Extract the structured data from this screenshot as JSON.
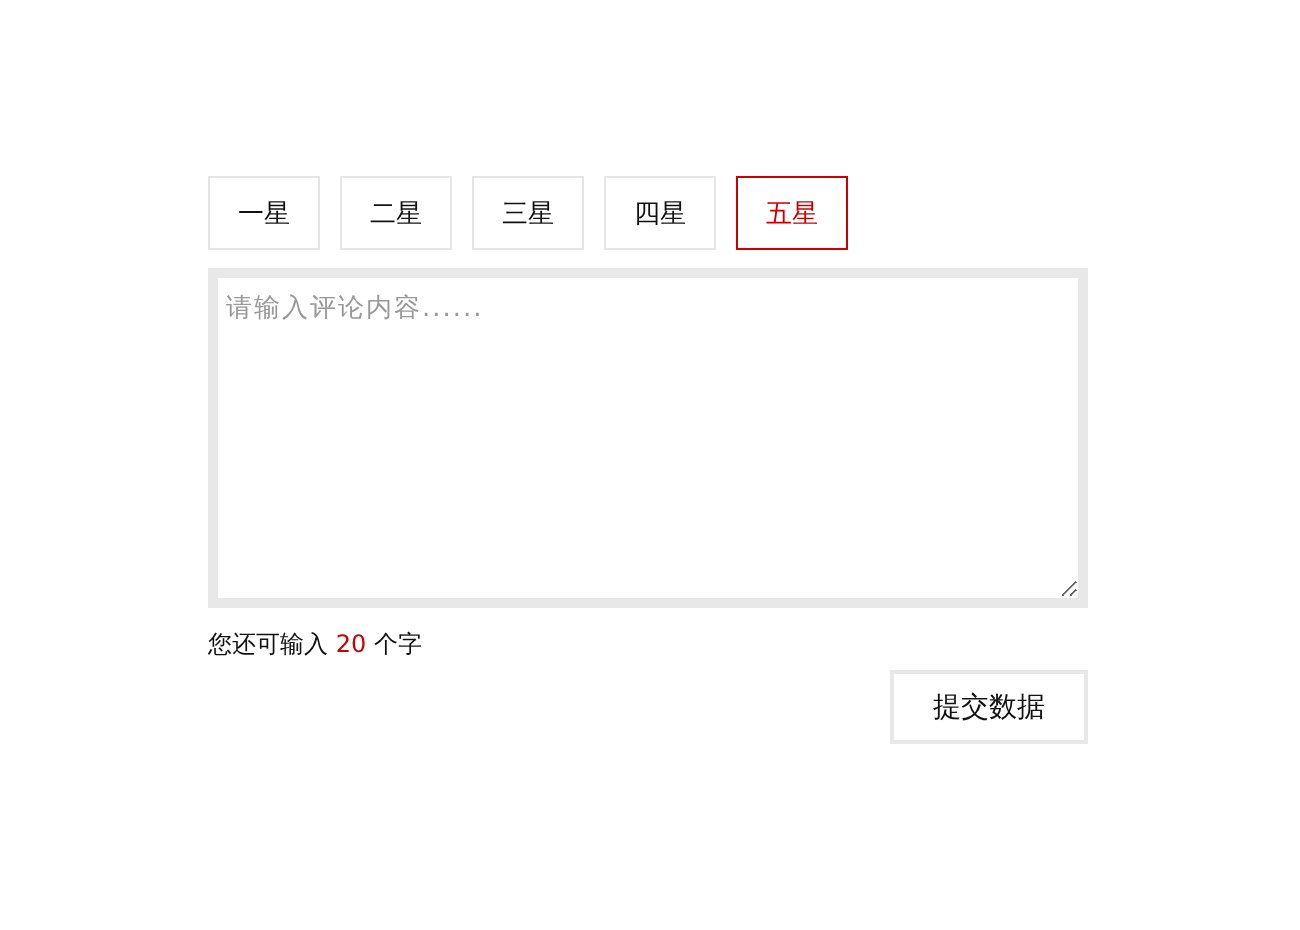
{
  "ratings": [
    {
      "label": "一星",
      "selected": false
    },
    {
      "label": "二星",
      "selected": false
    },
    {
      "label": "三星",
      "selected": false
    },
    {
      "label": "四星",
      "selected": false
    },
    {
      "label": "五星",
      "selected": true
    }
  ],
  "comment": {
    "placeholder": "请输入评论内容......"
  },
  "counter": {
    "prefix": "您还可输入",
    "count": "20",
    "suffix": "个字"
  },
  "submit": "提交数据"
}
